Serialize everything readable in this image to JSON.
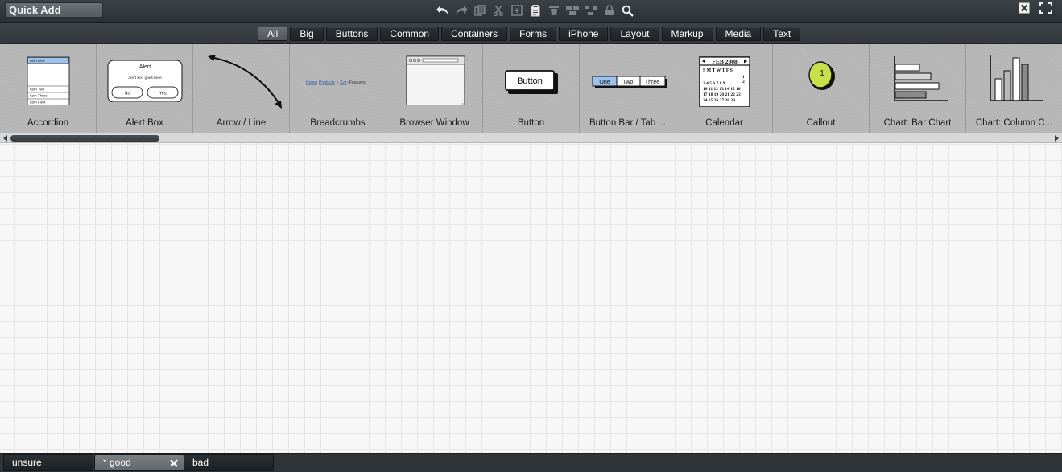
{
  "topbar": {
    "quick_add_value": "Quick Add",
    "icons": [
      "undo-icon",
      "redo-icon",
      "copy-icon",
      "cut-icon",
      "duplicate-icon",
      "paste-icon",
      "delete-icon",
      "group-icon",
      "ungroup-icon",
      "lock-icon",
      "search-icon"
    ],
    "window_icons": [
      "close-window-icon",
      "fullscreen-icon"
    ]
  },
  "categories": [
    {
      "label": "All",
      "active": true
    },
    {
      "label": "Big"
    },
    {
      "label": "Buttons"
    },
    {
      "label": "Common"
    },
    {
      "label": "Containers"
    },
    {
      "label": "Forms"
    },
    {
      "label": "iPhone"
    },
    {
      "label": "Layout"
    },
    {
      "label": "Markup"
    },
    {
      "label": "Media"
    },
    {
      "label": "Text"
    }
  ],
  "library": [
    {
      "label": "Accordion",
      "items": [
        "Item One",
        "Item Two",
        "Item Three",
        "Item Four"
      ]
    },
    {
      "label": "Alert Box",
      "title": "Alert",
      "text": "Alert text goes here",
      "no": "No",
      "yes": "Yes"
    },
    {
      "label": "Arrow / Line"
    },
    {
      "label": "Breadcrumbs",
      "crumbs": [
        "Home",
        "Products",
        "Xyz",
        "Features"
      ]
    },
    {
      "label": "Browser Window"
    },
    {
      "label": "Button",
      "button_text": "Button"
    },
    {
      "label": "Button Bar / Tab ...",
      "buttons": [
        "One",
        "Two",
        "Three"
      ]
    },
    {
      "label": "Calendar",
      "month": "FEB 2008",
      "days": "S M T W T F S"
    },
    {
      "label": "Callout",
      "number": "1"
    },
    {
      "label": "Chart: Bar Chart"
    },
    {
      "label": "Chart: Column C..."
    }
  ],
  "tabs": [
    {
      "label": "unsure"
    },
    {
      "label": "* good",
      "active": true
    },
    {
      "label": "bad"
    }
  ]
}
